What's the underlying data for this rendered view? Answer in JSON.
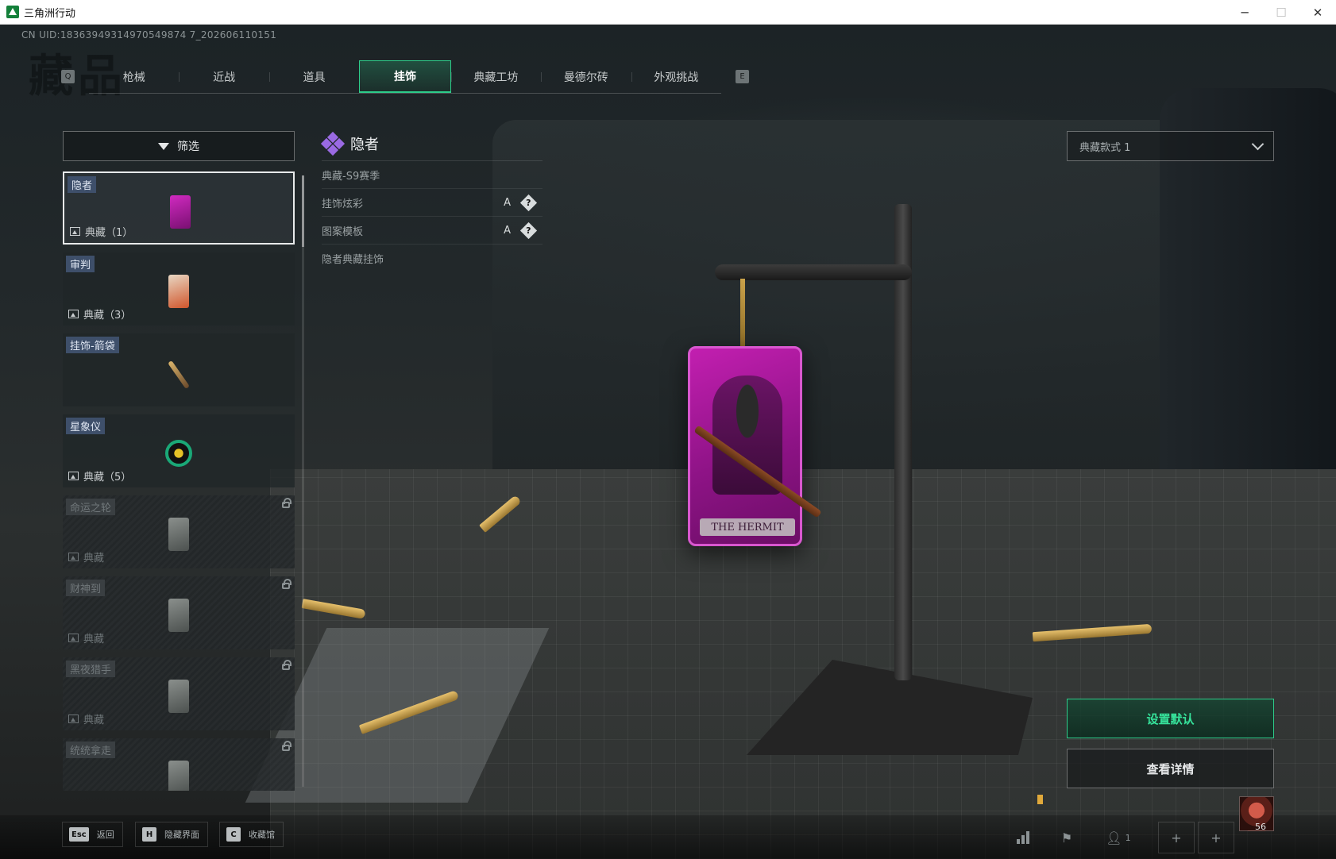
{
  "window": {
    "title": "三角洲行动",
    "controls": [
      "─",
      "☐",
      "✕"
    ]
  },
  "header": {
    "uid": "CN UID:18363949314970549874 7_202606110151",
    "page_title": "藏品"
  },
  "tabs": {
    "prev_key": "Q",
    "next_key": "E",
    "items": [
      {
        "label": "枪械"
      },
      {
        "label": "近战"
      },
      {
        "label": "道具"
      },
      {
        "label": "挂饰"
      },
      {
        "label": "典藏工坊"
      },
      {
        "label": "曼德尔砖"
      },
      {
        "label": "外观挑战"
      }
    ],
    "active_index": 3
  },
  "filter": {
    "label": "筛选"
  },
  "items": [
    {
      "name": "隐者",
      "count": "典藏（1）",
      "locked": false,
      "selected": true,
      "thumb": "pink-card"
    },
    {
      "name": "审判",
      "count": "典藏（3）",
      "locked": false,
      "selected": false,
      "thumb": "orange-card"
    },
    {
      "name": "挂饰-箭袋",
      "count": "",
      "locked": false,
      "selected": false,
      "thumb": "pen"
    },
    {
      "name": "星象仪",
      "count": "典藏（5）",
      "locked": false,
      "selected": false,
      "thumb": "ring"
    },
    {
      "name": "命运之轮",
      "count": "典藏",
      "locked": true,
      "selected": false,
      "thumb": "gray-card"
    },
    {
      "name": "财神到",
      "count": "典藏",
      "locked": true,
      "selected": false,
      "thumb": "gray-card"
    },
    {
      "name": "黑夜猎手",
      "count": "典藏",
      "locked": true,
      "selected": false,
      "thumb": "gray-card"
    },
    {
      "name": "统统拿走",
      "count": "",
      "locked": true,
      "selected": false,
      "thumb": "gray-card"
    }
  ],
  "detail": {
    "title": "隐者",
    "season": "典藏-S9赛季",
    "rows": [
      {
        "label": "挂饰炫彩",
        "grade": "A",
        "help": "?"
      },
      {
        "label": "图案模板",
        "grade": "A",
        "help": "?"
      }
    ],
    "description": "隐者典藏挂饰"
  },
  "charm": {
    "card_text": "THE HERMIT"
  },
  "style_select": {
    "value": "典藏款式 1"
  },
  "actions": {
    "set_default": "设置默认",
    "view_details": "查看详情"
  },
  "bottom": {
    "hints": [
      {
        "key": "Esc",
        "label": "返回"
      },
      {
        "key": "H",
        "label": "隐藏界面"
      },
      {
        "key": "C",
        "label": "收藏馆"
      }
    ],
    "squad_count": "1",
    "player_level": "56"
  },
  "colors": {
    "accent_green": "#2ecc8a",
    "rarity_purple": "#9a6ae3",
    "charm_magenta": "#c21fb0"
  }
}
